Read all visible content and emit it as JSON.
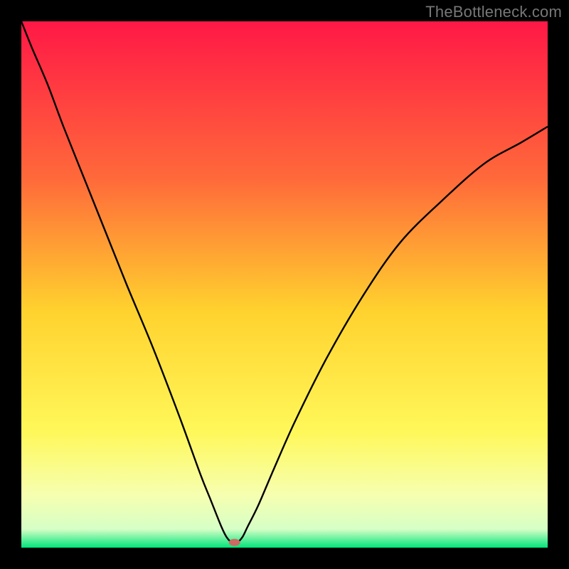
{
  "watermark": "TheBottleneck.com",
  "chart_data": {
    "type": "line",
    "title": "",
    "xlabel": "",
    "ylabel": "",
    "xlim": [
      0,
      100
    ],
    "ylim": [
      0,
      100
    ],
    "grid": false,
    "background_gradient_stops": [
      {
        "offset": 0,
        "color": "#ff1846"
      },
      {
        "offset": 0.3,
        "color": "#ff6a3a"
      },
      {
        "offset": 0.55,
        "color": "#ffd22e"
      },
      {
        "offset": 0.78,
        "color": "#fff85a"
      },
      {
        "offset": 0.9,
        "color": "#f6ffb0"
      },
      {
        "offset": 0.965,
        "color": "#d6ffc6"
      },
      {
        "offset": 1.0,
        "color": "#00e57a"
      }
    ],
    "series": [
      {
        "name": "curve",
        "color": "#000000",
        "x": [
          0,
          2,
          5,
          8,
          12,
          16,
          20,
          25,
          30,
          34,
          36,
          38,
          39,
          40,
          41,
          42,
          43,
          45,
          48,
          52,
          58,
          65,
          72,
          80,
          88,
          95,
          100
        ],
        "y": [
          100,
          95,
          88,
          80,
          70,
          60,
          50,
          38,
          25,
          14,
          9,
          4,
          2,
          1,
          1,
          2,
          4,
          8,
          15,
          24,
          36,
          48,
          58,
          66,
          73,
          77,
          80
        ]
      }
    ],
    "marker": {
      "name": "min-point",
      "x": 40.5,
      "y": 1,
      "rx": 8,
      "ry": 5,
      "color": "#cc6a63"
    }
  }
}
